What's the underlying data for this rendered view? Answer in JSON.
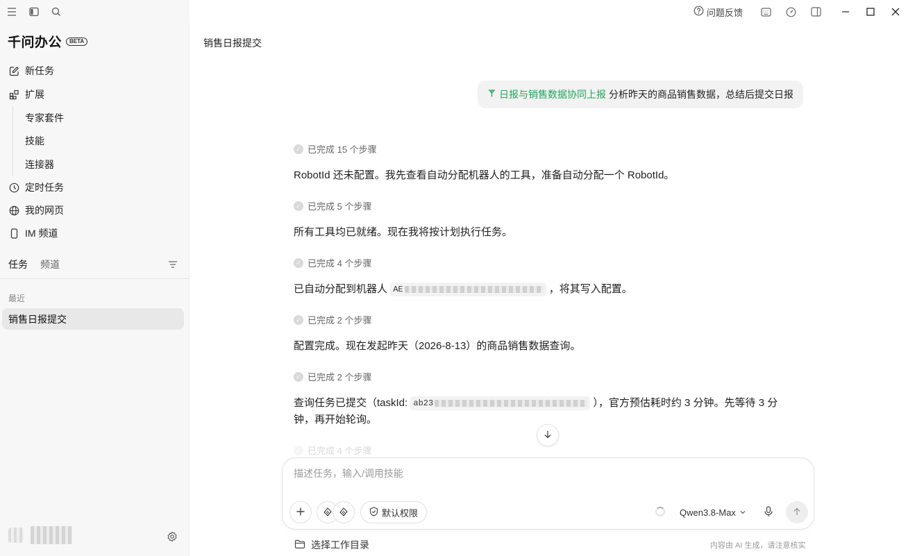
{
  "titlebar": {
    "feedback_label": "问题反馈"
  },
  "sidebar": {
    "brand": "千问办公",
    "beta": "BETA",
    "nav": {
      "new_task": "新任务",
      "extensions": "扩展",
      "expert_kits": "专家套件",
      "skills": "技能",
      "connectors": "连接器",
      "scheduled": "定时任务",
      "my_pages": "我的网页",
      "im_channel": "IM 频道"
    },
    "tabs": {
      "tasks": "任务",
      "channels": "频道"
    },
    "recent_label": "最近",
    "sessions": [
      "销售日报提交"
    ]
  },
  "main": {
    "title": "销售日报提交",
    "user_message": {
      "skill": "日报与销售数据协同上报",
      "text": "分析昨天的商品销售数据，总结后提交日报"
    },
    "steps": [
      {
        "label": "已完成 15 个步骤"
      },
      {
        "label": "已完成 5 个步骤"
      },
      {
        "label": "已完成 4 个步骤"
      },
      {
        "label": "已完成 2 个步骤"
      },
      {
        "label": "已完成 2 个步骤"
      },
      {
        "label": "已完成 4 个步骤"
      }
    ],
    "messages": {
      "m1": "RobotId 还未配置。我先查看自动分配机器人的工具，准备自动分配一个 RobotId。",
      "m2": "所有工具均已就绪。现在我将按计划执行任务。",
      "m3_prefix": "已自动分配到机器人",
      "m3_code": "AE",
      "m3_suffix": "，将其写入配置。",
      "m4": "配置完成。现在发起昨天（2026-8-13）的商品销售数据查询。",
      "m5_prefix": "查询任务已提交（taskId:",
      "m5_code": "ab23",
      "m5_suffix": "），官方预估耗时约 3 分钟。先等待 3 分钟，再开始轮询。"
    }
  },
  "composer": {
    "placeholder": "描述任务，输入/调用技能",
    "permission_label": "默认权限",
    "model": "Qwen3.8-Max"
  },
  "footer": {
    "workdir_label": "选择工作目录",
    "disclaimer": "内容由 AI 生成，请注意核实"
  },
  "colors": {
    "accent_green": "#1ea65c",
    "sidebar_bg": "#f7f7f7",
    "bubble_bg": "#f2f2f2"
  }
}
